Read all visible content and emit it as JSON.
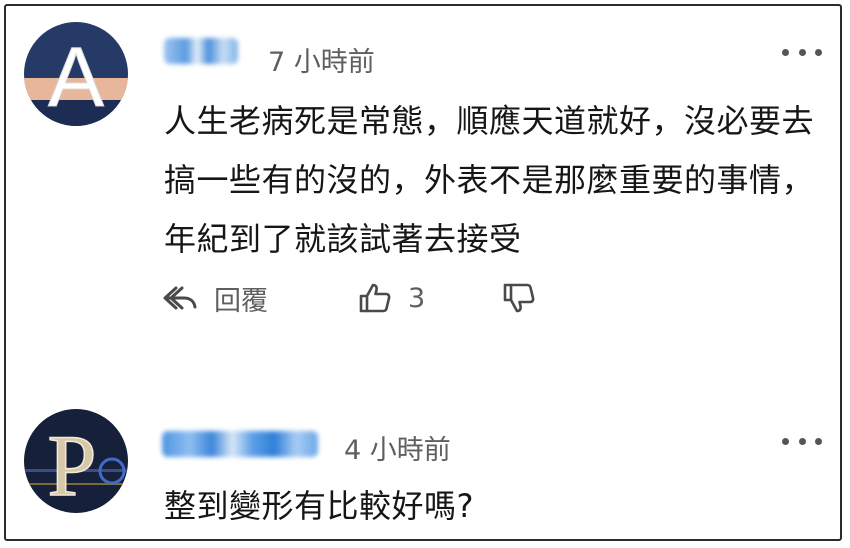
{
  "comments": [
    {
      "avatar_letter": "A",
      "timestamp": "7 小時前",
      "text": "人生老病死是常態，順應天道就好，沒必要去搞一些有的沒的，外表不是那麼重要的事情，年紀到了就該試著去接受",
      "reply_label": "回覆",
      "like_count": "3"
    },
    {
      "avatar_letter": "P",
      "timestamp": "4 小時前",
      "text": "整到變形有比較好嗎?"
    }
  ],
  "icons": {
    "more": "more-horizontal-icon",
    "reply": "reply-arrow-icon",
    "like": "thumbs-up-icon",
    "dislike": "thumbs-down-icon"
  },
  "colors": {
    "avatar_1_bg": "#253a66",
    "avatar_1_stripe": "#e8b79b",
    "avatar_2_bg": "#16203a",
    "username_blur": "#5a9be0",
    "timestamp": "#5f5f5f"
  }
}
